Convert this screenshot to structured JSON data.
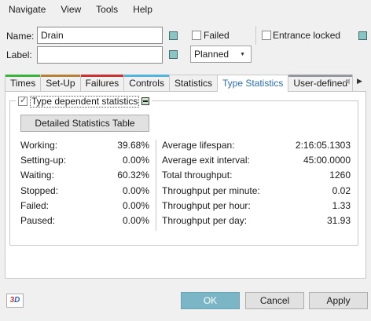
{
  "menu": {
    "items": [
      "Navigate",
      "View",
      "Tools",
      "Help"
    ]
  },
  "form": {
    "name_label": "Name:",
    "name_value": "Drain",
    "label_label": "Label:",
    "label_value": "",
    "failed_label": "Failed",
    "failed_checked": false,
    "entrance_locked_label": "Entrance locked",
    "entrance_locked_checked": false,
    "planned_value": "Planned"
  },
  "tabs": [
    {
      "label": "Times",
      "color": "#3cb43c",
      "active": false
    },
    {
      "label": "Set-Up",
      "color": "#b4823c",
      "active": false
    },
    {
      "label": "Failures",
      "color": "#c83232",
      "active": false
    },
    {
      "label": "Controls",
      "color": "#50b4dc",
      "active": false
    },
    {
      "label": "Statistics",
      "color": "",
      "active": false
    },
    {
      "label": "Type Statistics",
      "color": "",
      "active": true
    },
    {
      "label": "User-defined",
      "color": "#9696a0",
      "active": false
    }
  ],
  "group": {
    "legend": "Type dependent statistics",
    "checked": true,
    "button_label": "Detailed Statistics Table"
  },
  "stats_left": [
    {
      "label": "Working:",
      "value": "39.68%"
    },
    {
      "label": "Setting-up:",
      "value": "0.00%"
    },
    {
      "label": "Waiting:",
      "value": "60.32%"
    },
    {
      "label": "Stopped:",
      "value": "0.00%"
    },
    {
      "label": "Failed:",
      "value": "0.00%"
    },
    {
      "label": "Paused:",
      "value": "0.00%"
    }
  ],
  "stats_right": [
    {
      "label": "Average lifespan:",
      "value": "2:16:05.1303"
    },
    {
      "label": "Average exit interval:",
      "value": "45:00.0000"
    },
    {
      "label": "Total throughput:",
      "value": "1260"
    },
    {
      "label": "Throughput per minute:",
      "value": "0.02"
    },
    {
      "label": "Throughput per hour:",
      "value": "1.33"
    },
    {
      "label": "Throughput per day:",
      "value": "31.93"
    }
  ],
  "buttons": {
    "ok": "OK",
    "cancel": "Cancel",
    "apply": "Apply"
  },
  "icon_3d": {
    "digit": "3",
    "letter": "D"
  },
  "colors": {
    "attribute_square": "#8cc4c4",
    "ok_button": "#7ab6c6",
    "active_tab_text": "#2a6fb0"
  }
}
